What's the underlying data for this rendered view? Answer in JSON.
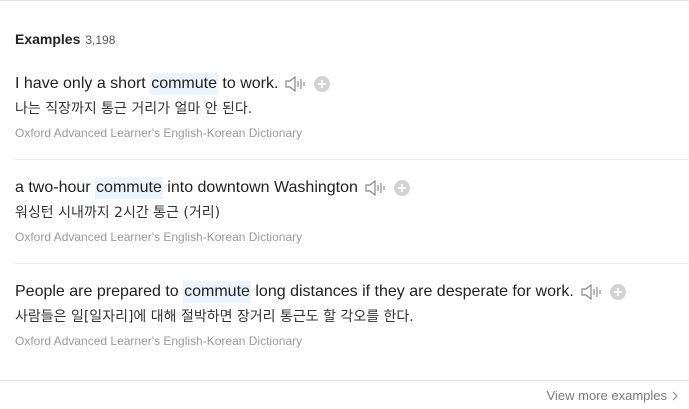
{
  "header": {
    "title": "Examples",
    "count": "3,198"
  },
  "examples": [
    {
      "before": "I have only a short ",
      "highlight": "commute",
      "after": " to work.",
      "translation": "나는 직장까지 통근 거리가 얼마 안 된다.",
      "source": "Oxford Advanced Learner's English-Korean Dictionary"
    },
    {
      "before": "a two-hour ",
      "highlight": "commute",
      "after": " into downtown Washington",
      "translation": "워싱턴 시내까지 2시간 통근 (거리)",
      "source": "Oxford Advanced Learner's English-Korean Dictionary"
    },
    {
      "before": "People are prepared to ",
      "highlight": "commute",
      "after": " long distances if they are desperate for work.",
      "translation": "사람들은 일[일자리]에 대해 절박하면 장거리 통근도 할 각오를 한다.",
      "source": "Oxford Advanced Learner's English-Korean Dictionary"
    }
  ],
  "footer": {
    "more_label": "View more examples"
  },
  "icons": {
    "audio": "speaker-icon",
    "add": "plus-circle-icon",
    "more": "chevron-right-icon"
  },
  "colors": {
    "highlight_bg": "#eaf3fe",
    "source_text": "#9a9a9a",
    "plus_bg": "#d3d3d3"
  }
}
